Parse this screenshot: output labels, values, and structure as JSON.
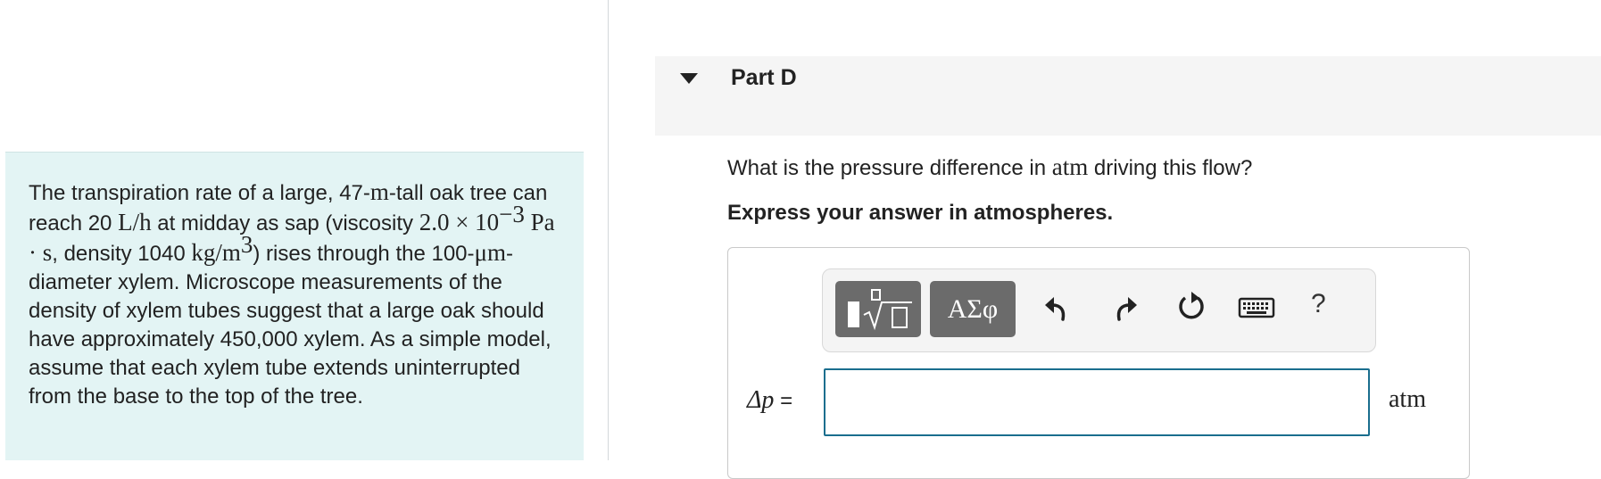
{
  "problem": {
    "t1": "The transpiration rate of a large, 47-",
    "u_m": "m",
    "t2": "-tall oak tree can reach 20 ",
    "u_Lh": "L/h",
    "t3": " at midday as sap (viscosity ",
    "visc_base": "2.0 × 10",
    "visc_exp": "−3",
    "u_Pas": " Pa · s",
    "t4": ", density 1040 ",
    "u_kgm": "kg/m",
    "u_kgm_exp": "3",
    "t5": ") rises through the 100-",
    "u_um": "μm",
    "t6": "-diameter xylem. Microscope measurements of the density of xylem tubes suggest that a large oak should have approximately 450,000 xylem. As a simple model, assume that each xylem tube extends uninterrupted from the base to the top of the tree."
  },
  "part": {
    "title": "Part D"
  },
  "question": {
    "pre": "What is the pressure difference in ",
    "unit": "atm",
    "post": " driving this flow?"
  },
  "instruction": "Express your answer in atmospheres.",
  "toolbar": {
    "greek_label": "ΑΣφ",
    "help_label": "?",
    "icons": [
      "templates-icon",
      "greek-letters-icon",
      "undo-icon",
      "redo-icon",
      "reset-icon",
      "keyboard-icon",
      "help-icon"
    ]
  },
  "answer": {
    "lhs_var": "Δp",
    "lhs_eq": " =",
    "value": "",
    "unit": "atm"
  },
  "colors": {
    "problem_bg": "#e3f4f4",
    "input_border": "#1a6e8e",
    "toolbar_btn": "#6b6b6b"
  }
}
